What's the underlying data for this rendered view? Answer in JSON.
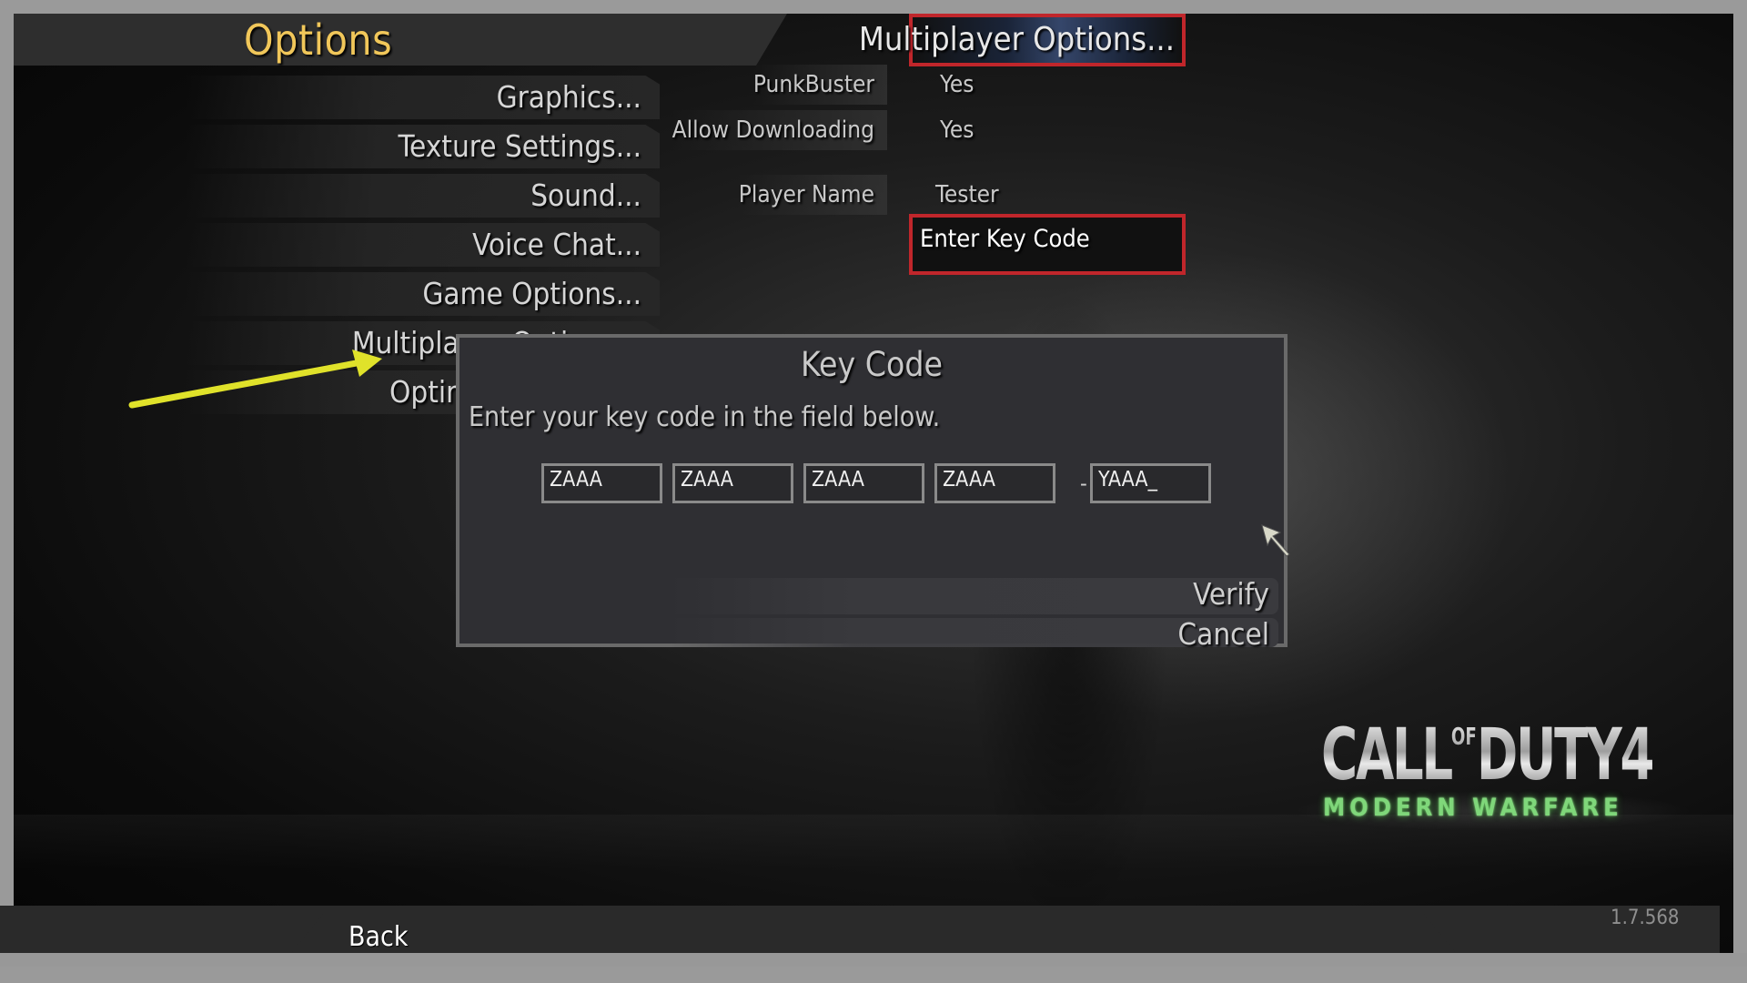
{
  "header": {
    "title": "Options"
  },
  "menu": {
    "items": [
      {
        "label": "Graphics..."
      },
      {
        "label": "Texture Settings..."
      },
      {
        "label": "Sound..."
      },
      {
        "label": "Voice Chat..."
      },
      {
        "label": "Game Options..."
      },
      {
        "label": "Multiplayer Options..."
      },
      {
        "label": "Optimal Settings..."
      }
    ]
  },
  "multiplayer": {
    "header_label": "Multiplayer Options...",
    "settings": [
      {
        "label": "PunkBuster",
        "value": "Yes"
      },
      {
        "label": "Allow Downloading",
        "value": "Yes"
      },
      {
        "label": "Player Name",
        "value": "Tester"
      }
    ],
    "enter_key_code_label": "Enter Key Code"
  },
  "dialog": {
    "title": "Key Code",
    "message": "Enter your key code in the field below.",
    "fields": [
      "ZAAA",
      "ZAAA",
      "ZAAA",
      "ZAAA",
      "YAAA_"
    ],
    "separator": "-",
    "verify_label": "Verify",
    "cancel_label": "Cancel"
  },
  "logo": {
    "call": "CALL",
    "of": "OF",
    "duty": "DUTY4",
    "subtitle": "MODERN WARFARE"
  },
  "footer": {
    "back_label": "Back",
    "version": "1.7.568"
  },
  "colors": {
    "title": "#f1c75a",
    "highlight_border": "#c0262b",
    "annotation_arrow": "#e0e22a",
    "logo_green": "#7fd77a"
  }
}
